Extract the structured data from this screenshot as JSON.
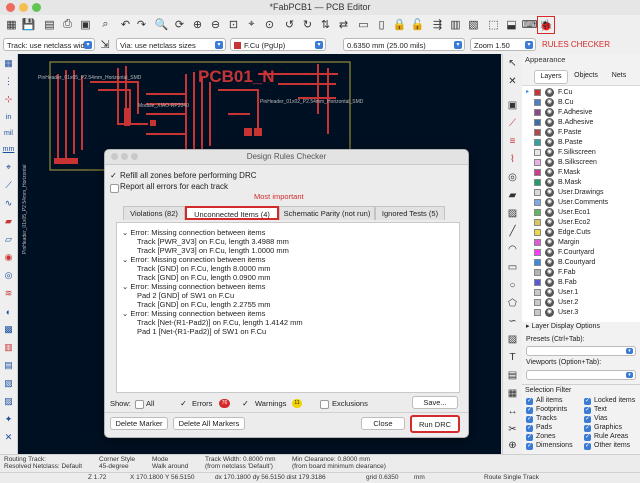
{
  "window": {
    "title": "*FabPCB1 — PCB Editor"
  },
  "toolbar2": {
    "track_combo": "Track: use netclass width",
    "via_combo": "Via: use netclass sizes",
    "layer_combo": "F.Cu (PgUp)",
    "grid_combo": "0.6350 mm (25.00 mils)",
    "zoom_combo": "Zoom 1.50",
    "rules_checker_label": "RULES CHECKER"
  },
  "left_toolbar": {
    "in_label": "in",
    "mil_label": "mil",
    "mm_label": "mm"
  },
  "canvas": {
    "board_label": "PCB01_N",
    "footprint_left": "PinHeader_01x05_P2.54mm_Horizontal",
    "footprint_top": "PinHeader_01x05_P2.54mm_Horizontal_SMD",
    "footprint_mid": "Module_XIAO-RP2040",
    "footprint_right": "PinHeader_01x02_P2.54mm_Horizontal_SMD"
  },
  "appearance": {
    "title": "Appearance",
    "tabs": [
      "Layers",
      "Objects",
      "Nets"
    ],
    "layers": [
      {
        "name": "F.Cu",
        "color": "#c83434"
      },
      {
        "name": "B.Cu",
        "color": "#4d7fc4"
      },
      {
        "name": "F.Adhesive",
        "color": "#8a4a8a"
      },
      {
        "name": "B.Adhesive",
        "color": "#3a6fa8"
      },
      {
        "name": "F.Paste",
        "color": "#b04a4a"
      },
      {
        "name": "B.Paste",
        "color": "#2fa39e"
      },
      {
        "name": "F.Silkscreen",
        "color": "#e6e6e6"
      },
      {
        "name": "B.Silkscreen",
        "color": "#e8b0e6"
      },
      {
        "name": "F.Mask",
        "color": "#d03a8a"
      },
      {
        "name": "B.Mask",
        "color": "#1e9e6a"
      },
      {
        "name": "User.Drawings",
        "color": "#d8d8d8"
      },
      {
        "name": "User.Comments",
        "color": "#7fa9e0"
      },
      {
        "name": "User.Eco1",
        "color": "#5fb85f"
      },
      {
        "name": "User.Eco2",
        "color": "#d8c85a"
      },
      {
        "name": "Edge.Cuts",
        "color": "#e8d84a"
      },
      {
        "name": "Margin",
        "color": "#e05ad8"
      },
      {
        "name": "F.Courtyard",
        "color": "#ff3aff"
      },
      {
        "name": "B.Courtyard",
        "color": "#3a8ae0"
      },
      {
        "name": "F.Fab",
        "color": "#b4b4b4"
      },
      {
        "name": "B.Fab",
        "color": "#5a5ad8"
      },
      {
        "name": "User.1",
        "color": "#c8c8c8"
      },
      {
        "name": "User.2",
        "color": "#c8c8c8"
      },
      {
        "name": "User.3",
        "color": "#c8c8c8"
      }
    ],
    "layer_display_options": "Layer Display Options",
    "presets_label": "Presets (Ctrl+Tab):",
    "viewports_label": "Viewports (Option+Tab):"
  },
  "selection_filter": {
    "title": "Selection Filter",
    "items": [
      "All items",
      "Locked items",
      "Footprints",
      "Text",
      "Tracks",
      "Vias",
      "Pads",
      "Graphics",
      "Zones",
      "Rule Areas",
      "Dimensions",
      "Other items"
    ]
  },
  "dialog": {
    "title": "Design Rules Checker",
    "refill_label": "Refill all zones before performing DRC",
    "report_all_label": "Report all errors for each track",
    "annotation": "Most important",
    "tabs": {
      "violations": "Violations (82)",
      "unconnected": "Unconnected Items (4)",
      "parity": "Schematic Parity (not run)",
      "ignored": "Ignored Tests (5)"
    },
    "errors": [
      {
        "title": "Error: Missing connection between items",
        "lines": [
          "Track [PWR_3V3] on F.Cu, length 3.4988 mm",
          "Track [PWR_3V3] on F.Cu, length 1.0000 mm"
        ]
      },
      {
        "title": "Error: Missing connection between items",
        "lines": [
          "Track [GND] on F.Cu, length 8.0000 mm",
          "Track [GND] on F.Cu, length 0.0900 mm"
        ]
      },
      {
        "title": "Error: Missing connection between items",
        "lines": [
          "Pad 2 [GND] of SW1 on F.Cu",
          "Track [GND] on F.Cu, length 2.2755 mm"
        ]
      },
      {
        "title": "Error: Missing connection between items",
        "lines": [
          "Track [Net-(R1-Pad2)] on F.Cu, length 1.4142 mm",
          "Pad 1 [Net-(R1-Pad2)] of SW1 on F.Cu"
        ]
      }
    ],
    "show_label": "Show:",
    "all_label": "All",
    "errors_label": "Errors",
    "errors_count": "76",
    "warnings_label": "Warnings",
    "warnings_count": "11",
    "exclusions_label": "Exclusions",
    "save_button": "Save...",
    "delete_marker": "Delete Marker",
    "delete_all_markers": "Delete All Markers",
    "close_button": "Close",
    "run_drc_button": "Run DRC"
  },
  "status_bar": {
    "routing_label": "Routing Track:",
    "resolved_label": "Resolved Netclass: Default",
    "corner_label": "Corner Style",
    "corner_value": "45-degree",
    "mode_label": "Mode",
    "mode_value": "Walk around",
    "track_width_label": "Track Width: 0.8000 mm",
    "track_width_sub": "(from netclass 'Default')",
    "min_clear_label": "Min Clearance: 0.8000 mm",
    "min_clear_sub": "(from board minimum clearance)",
    "z": "Z 1.72",
    "xy": "X 170.1800  Y 56.5150",
    "dxy": "dx 170.1800  dy 56.5150  dist 179.3186",
    "grid": "grid 0.6350",
    "unit": "mm",
    "route_mode": "Route Single Track"
  }
}
